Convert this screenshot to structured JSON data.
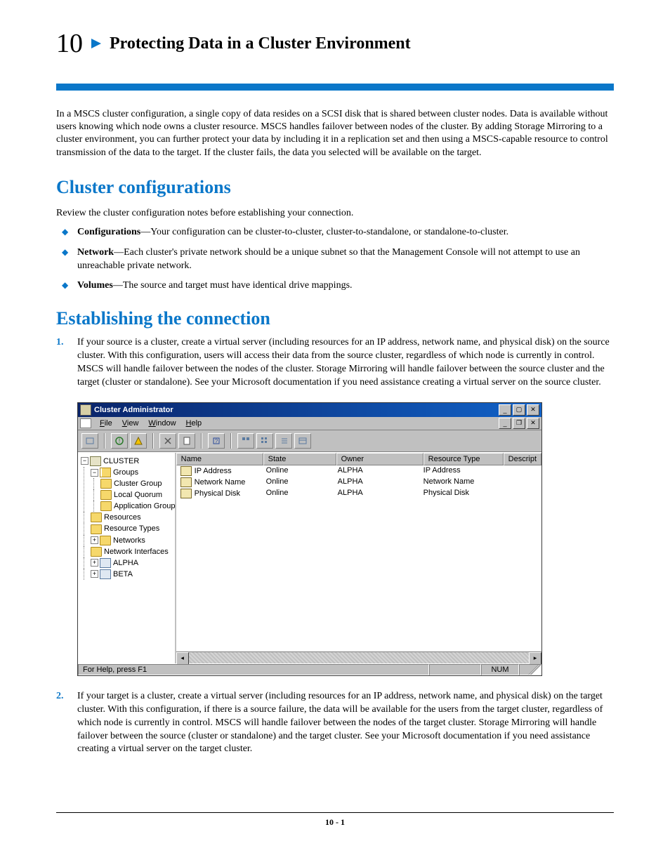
{
  "chapter": {
    "number": "10",
    "title": "Protecting Data in a Cluster Environment"
  },
  "intro_text": "In a MSCS cluster configuration, a single copy of data resides on a SCSI disk that is shared between cluster nodes. Data is available without users knowing which node owns a cluster resource. MSCS handles failover between nodes of the cluster. By adding Storage Mirroring to a cluster environment, you can further protect your data by including it in a replication set and then using a MSCS-capable resource to control transmission of the data to the target. If the cluster fails, the data you selected will be available on the target.",
  "section1": {
    "title": "Cluster configurations",
    "lead": "Review the cluster configuration notes before establishing your connection.",
    "bullets": [
      {
        "term": "Configurations",
        "text": "—Your configuration can be cluster-to-cluster, cluster-to-standalone, or standalone-to-cluster."
      },
      {
        "term": "Network",
        "text": "—Each cluster's private network should be a unique subnet so that the Management Console will not attempt to use an unreachable private network."
      },
      {
        "term": "Volumes",
        "text": "—The source and target must have identical drive mappings."
      }
    ]
  },
  "section2": {
    "title": "Establishing the connection",
    "steps": [
      "If your source is a cluster, create a virtual server (including resources for an IP address, network name, and physical disk) on the source cluster. With this configuration, users will access their data from the source cluster, regardless of which node is currently in control. MSCS will handle failover between the nodes of the cluster. Storage Mirroring will handle failover between the source cluster and the target (cluster or standalone). See your Microsoft documentation if you need assistance creating a virtual server on the source cluster.",
      "If your target is a cluster, create a virtual server (including resources for an IP address, network name, and physical disk) on the target cluster. With this configuration, if there is a source failure, the data will be available for the users from the target cluster, regardless of which node is currently in control. MSCS will handle failover between the nodes of the target cluster. Storage Mirroring will handle failover between the source (cluster or standalone) and the target cluster. See your Microsoft documentation if you need assistance creating a virtual server on the target cluster."
    ]
  },
  "screenshot": {
    "window_title": "Cluster Administrator",
    "menus": {
      "file": "File",
      "view": "View",
      "window": "Window",
      "help": "Help"
    },
    "tree": {
      "root": "CLUSTER",
      "groups": "Groups",
      "cluster_group": "Cluster Group",
      "local_quorum": "Local Quorum",
      "application_group": "Application Group",
      "resources": "Resources",
      "resource_types": "Resource Types",
      "networks": "Networks",
      "network_interfaces": "Network Interfaces",
      "alpha": "ALPHA",
      "beta": "BETA"
    },
    "columns": {
      "name": "Name",
      "state": "State",
      "owner": "Owner",
      "rtype": "Resource Type",
      "desc": "Descript"
    },
    "rows": [
      {
        "name": "IP Address",
        "state": "Online",
        "owner": "ALPHA",
        "rtype": "IP Address"
      },
      {
        "name": "Network Name",
        "state": "Online",
        "owner": "ALPHA",
        "rtype": "Network Name"
      },
      {
        "name": "Physical Disk",
        "state": "Online",
        "owner": "ALPHA",
        "rtype": "Physical Disk"
      }
    ],
    "statusbar": {
      "help": "For Help, press F1",
      "num": "NUM"
    }
  },
  "footer": "10 - 1"
}
